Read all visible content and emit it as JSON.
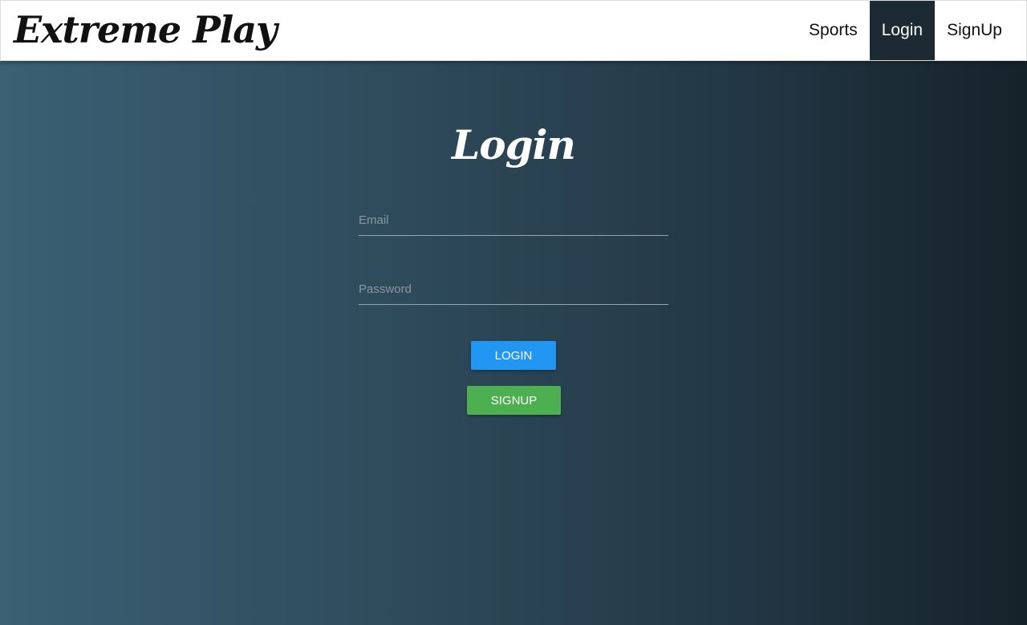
{
  "navbar": {
    "brand": "Extreme Play",
    "links": [
      {
        "label": "Sports",
        "active": false
      },
      {
        "label": "Login",
        "active": true
      },
      {
        "label": "SignUp",
        "active": false
      }
    ]
  },
  "login": {
    "title": "Login",
    "email": {
      "placeholder": "Email",
      "value": ""
    },
    "password": {
      "placeholder": "Password",
      "value": ""
    },
    "login_button": "LOGIN",
    "signup_button": "SIGNUP"
  },
  "colors": {
    "background_gradient": [
      "#3a6073",
      "#16222a"
    ],
    "nav_active": "#1b2a33",
    "login_button": "#2196f3",
    "signup_button": "#4caf50"
  }
}
